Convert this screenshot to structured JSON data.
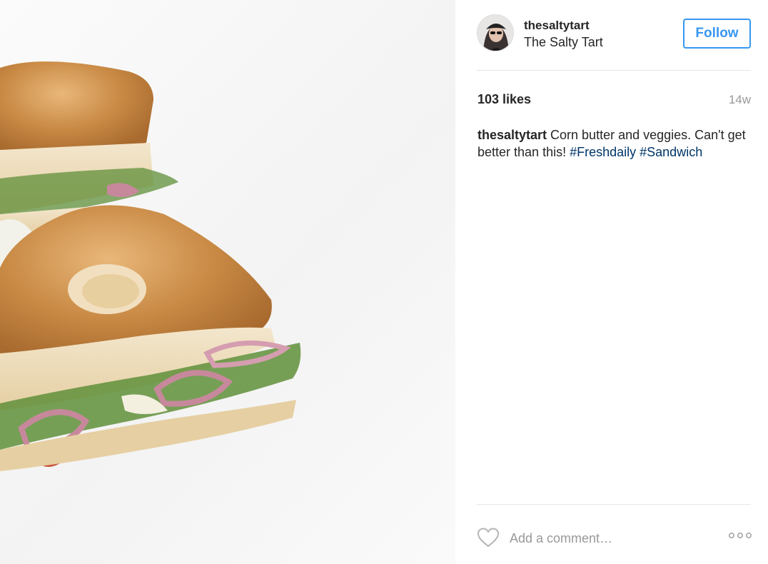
{
  "post": {
    "image_alt": "Focaccia sandwich with corn butter and veggies",
    "author": {
      "username": "thesaltytart",
      "full_name": "The Salty Tart"
    },
    "follow_label": "Follow",
    "likes_text": "103 likes",
    "timestamp": "14w",
    "caption": {
      "username": "thesaltytart",
      "text": " Corn butter and veggies. Can't get better than this! ",
      "hashtags": [
        "#Freshdaily",
        "#Sandwich"
      ]
    },
    "comment_placeholder": "Add a comment…"
  },
  "colors": {
    "accent": "#3897f0",
    "hashtag": "#003569",
    "muted": "#999999",
    "text": "#262626"
  },
  "icons": {
    "like": "heart-outline-icon",
    "options": "more-options-icon"
  }
}
